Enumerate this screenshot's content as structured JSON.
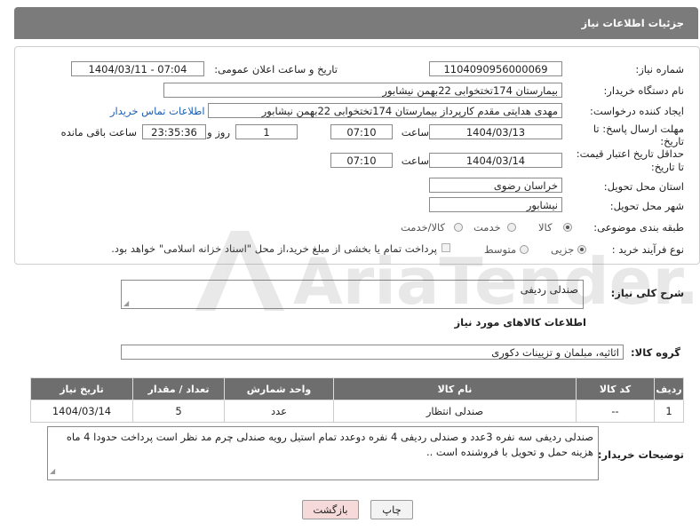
{
  "header": {
    "title": "جزئیات اطلاعات نیاز"
  },
  "form": {
    "need_number_label": "شماره نیاز:",
    "need_number": "1104090956000069",
    "announce_label": "تاریخ و ساعت اعلان عمومی:",
    "announce_value": "1404/03/11 - 07:04",
    "buyer_org_label": "نام دستگاه خریدار:",
    "buyer_org": "بیمارستان 174تختخوابی 22بهمن نیشابور",
    "creator_label": "ایجاد کننده درخواست:",
    "creator": "مهدی هدایتی مقدم کارپرداز بیمارستان 174تختخوابی 22بهمن نیشابور",
    "contact_link": "اطلاعات تماس خریدار",
    "deadline_label_1": "مهلت ارسال پاسخ: تا",
    "deadline_label_2": "تاریخ:",
    "deadline_date": "1404/03/13",
    "time_label": "ساعت",
    "deadline_time": "07:10",
    "days_value": "1",
    "days_label": "روز و",
    "remaining_value": "23:35:36",
    "remaining_label": "ساعت باقی مانده",
    "validity_label_1": "حداقل تاریخ اعتبار قیمت:",
    "validity_label_2": "تا تاریخ:",
    "validity_date": "1404/03/14",
    "validity_time": "07:10",
    "province_label": "استان محل تحویل:",
    "province": "خراسان رضوی",
    "city_label": "شهر محل تحویل:",
    "city": "نیشابور",
    "category_label": "طبقه بندی موضوعی:",
    "category_options": [
      "کالا",
      "خدمت",
      "کالا/خدمت"
    ],
    "process_label": "نوع فرآیند خرید :",
    "process_options": [
      "جزیی",
      "متوسط"
    ],
    "payment_note": "پرداخت تمام یا بخشی از مبلغ خرید،از محل \"اسناد خزانه اسلامی\" خواهد بود."
  },
  "description": {
    "label": "شرح کلی نیاز:",
    "value": "صندلی ردیفی"
  },
  "goods": {
    "section_title": "اطلاعات کالاهای مورد نیاز",
    "group_label": "گروه کالا:",
    "group_value": "اثاثیه، مبلمان و تزیینات دکوری",
    "columns": [
      "ردیف",
      "کد کالا",
      "نام کالا",
      "واحد شمارش",
      "تعداد / مقدار",
      "تاریخ نیاز"
    ],
    "rows": [
      [
        "1",
        "--",
        "صندلی انتظار",
        "عدد",
        "5",
        "1404/03/14"
      ]
    ]
  },
  "buyer_notes": {
    "label": "توضیحات خریدار:",
    "value": "صندلی ردیفی سه نفره 3عدد و صندلی ردیفی 4 نفره دوعدد تمام استیل رویه صندلی چرم مد نظر است پرداخت حدودا 4 ماه هزینه حمل و تحویل با فروشنده است .."
  },
  "buttons": {
    "print": "چاپ",
    "back": "بازگشت"
  },
  "watermark": {
    "text": "AriaTender.net"
  },
  "colors": {
    "header": "#7b7b7b",
    "link": "#1a5fb4",
    "back_button": "#f6dada"
  }
}
